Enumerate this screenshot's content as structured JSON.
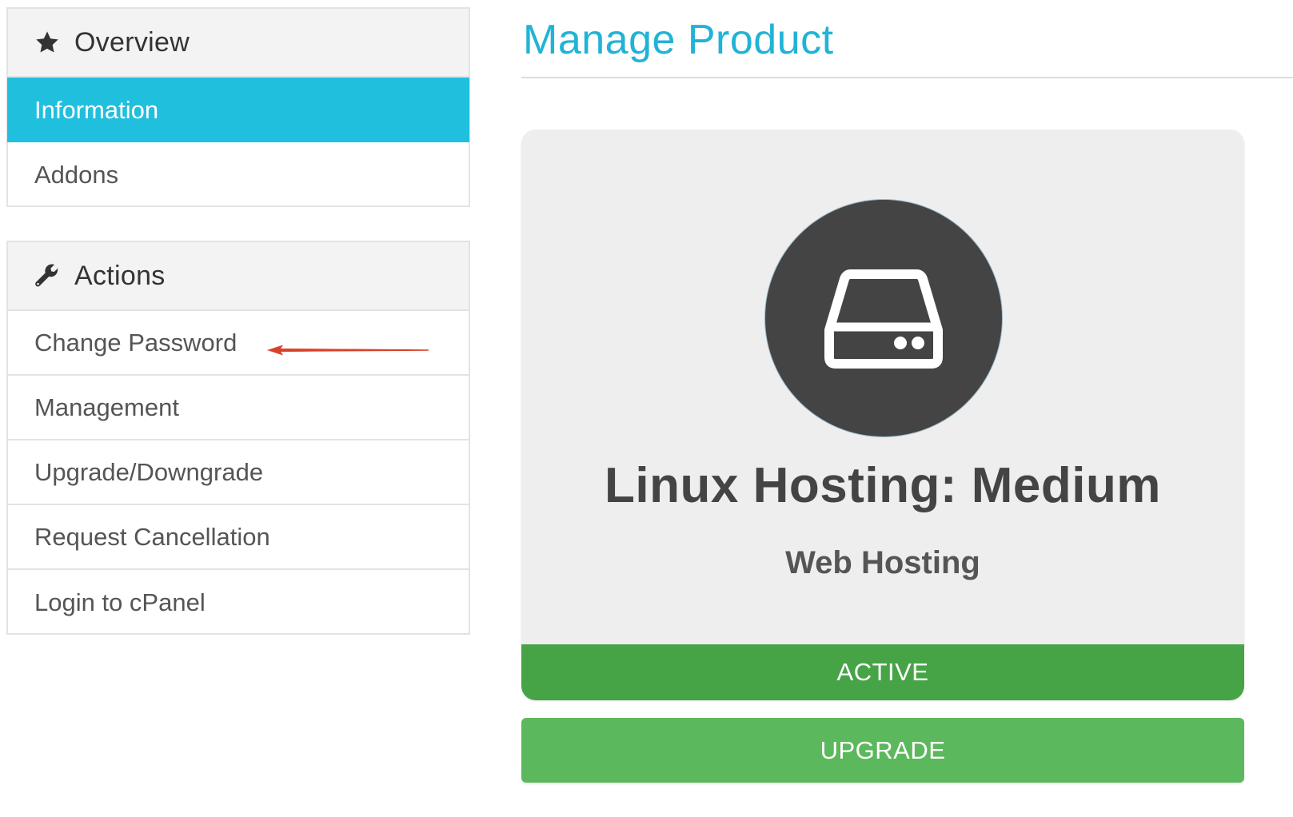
{
  "sidebar": {
    "overview": {
      "title": "Overview",
      "icon": "star-icon",
      "items": [
        {
          "label": "Information",
          "active": true
        },
        {
          "label": "Addons",
          "active": false
        }
      ]
    },
    "actions": {
      "title": "Actions",
      "icon": "wrench-icon",
      "items": [
        {
          "label": "Change Password"
        },
        {
          "label": "Management"
        },
        {
          "label": "Upgrade/Downgrade"
        },
        {
          "label": "Request Cancellation"
        },
        {
          "label": "Login to cPanel"
        }
      ]
    }
  },
  "main": {
    "title": "Manage Product",
    "product": {
      "icon": "hard-drive-icon",
      "name": "Linux Hosting: Medium",
      "group": "Web Hosting",
      "status": "ACTIVE"
    },
    "upgrade_label": "UPGRADE"
  },
  "annotation": {
    "icon": "red-arrow-icon"
  },
  "colors": {
    "accent": "#21bfde",
    "title": "#21b3d6",
    "status_active": "#46a447",
    "upgrade": "#5cb85c",
    "icon_circle": "#444444",
    "annotation_arrow": "#d9412b"
  }
}
